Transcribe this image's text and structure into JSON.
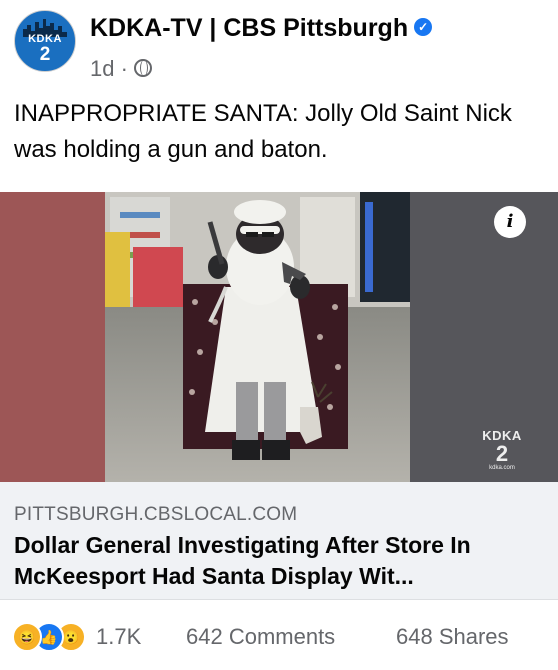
{
  "post": {
    "page_name": "KDKA-TV | CBS Pittsburgh",
    "avatar_text": "KDKA",
    "avatar_number": "2",
    "time_ago": "1d",
    "separator": "·",
    "audience_icon": "globe-icon",
    "verified_icon": "verified-badge-icon",
    "caption": "INAPPROPRIATE SANTA: Jolly Old Saint Nick was holding a gun and baton."
  },
  "photo": {
    "description_icon": "info-icon",
    "info_label": "i",
    "watermark_name": "KDKA",
    "watermark_number": "2",
    "watermark_url": "kdka.com"
  },
  "link": {
    "domain": "PITTSBURGH.CBSLOCAL.COM",
    "title": "Dollar General Investigating After Store In McKeesport Had Santa Display Wit..."
  },
  "engagement": {
    "reaction_icons": [
      "haha-reaction-icon",
      "like-reaction-icon",
      "wow-reaction-icon"
    ],
    "reactions_count": "1.7K",
    "comments": "642 Comments",
    "shares": "648 Shares"
  },
  "colors": {
    "brand_blue": "#1877f2",
    "kdka_blue": "#1a6fc0",
    "secondary_text": "#65676b",
    "card_bg": "#f0f2f5"
  }
}
